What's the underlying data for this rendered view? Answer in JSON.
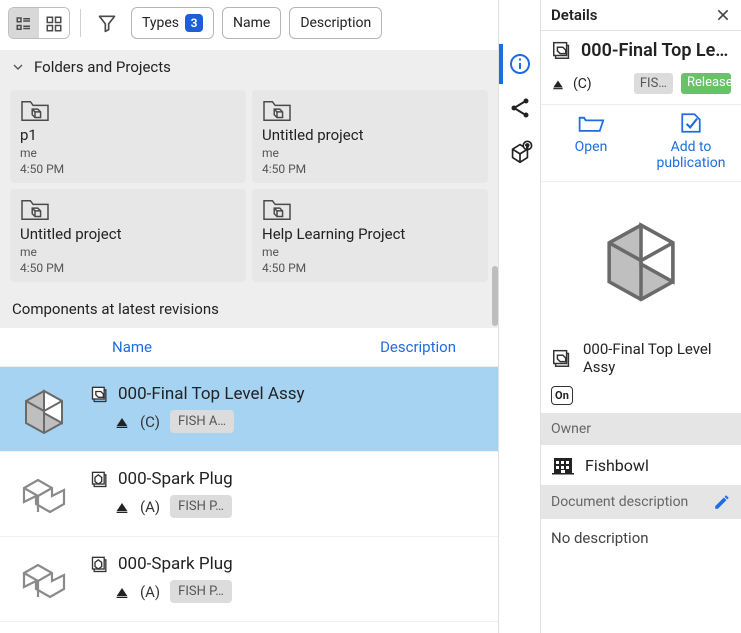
{
  "toolbar": {
    "filters": {
      "types": {
        "label": "Types",
        "count": "3"
      },
      "name": {
        "label": "Name"
      },
      "description": {
        "label": "Description"
      }
    }
  },
  "folders_section_title": "Folders and Projects",
  "folders": [
    {
      "title": "p1",
      "owner": "me",
      "time": "4:50 PM"
    },
    {
      "title": "Untitled project",
      "owner": "me",
      "time": "4:50 PM"
    },
    {
      "title": "Untitled project",
      "owner": "me",
      "time": "4:50 PM"
    },
    {
      "title": "Help Learning Project",
      "owner": "me",
      "time": "4:50 PM"
    }
  ],
  "components_section_title": "Components at latest revisions",
  "columns": {
    "name": "Name",
    "description": "Description"
  },
  "components": [
    {
      "name": "000-Final Top Level Assy",
      "rev": "(C)",
      "tag": "FISH A…",
      "type": "assembly",
      "selected": true
    },
    {
      "name": "000-Spark Plug",
      "rev": "(A)",
      "tag": "FISH P…",
      "type": "part",
      "selected": false
    },
    {
      "name": "000-Spark Plug",
      "rev": "(A)",
      "tag": "FISH P…",
      "type": "part",
      "selected": false
    }
  ],
  "details": {
    "header": "Details",
    "title": "000-Final Top Lev…",
    "rev": "(C)",
    "tag": "FIS…",
    "status": "Released",
    "actions": {
      "open": "Open",
      "add_pub": "Add to publication"
    },
    "full_name": "000-Final Top Level Assy",
    "provider_badge": "On",
    "owner_label": "Owner",
    "owner": "Fishbowl",
    "desc_label": "Document description",
    "desc_text": "No description"
  }
}
